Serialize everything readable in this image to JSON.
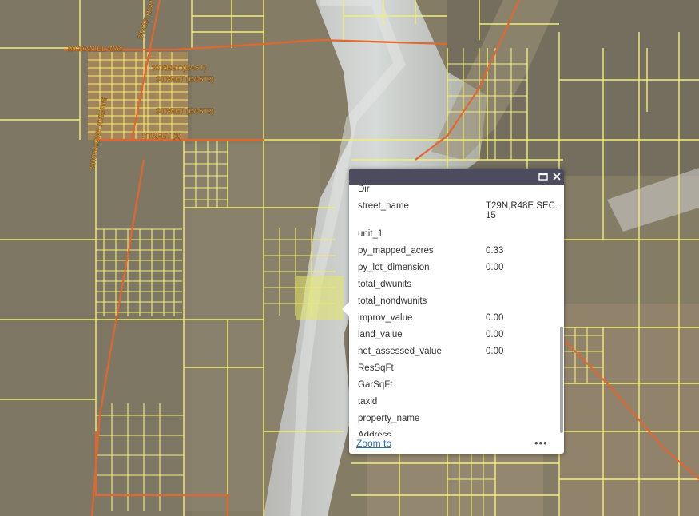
{
  "map": {
    "street_labels": [
      "MCDANIEL WAY",
      "SHOSHONE AVENUE",
      "STATE ROUTE",
      "STREET (EAST)",
      "STREET (EAST2)",
      "STREET (EAST2)",
      "STREET (1)"
    ],
    "colors": {
      "parcel": "#f4ef74",
      "road": "#e2672e",
      "label": "#f2a33a"
    }
  },
  "popup": {
    "maximize_icon": "maximize-icon",
    "close_icon": "close-icon",
    "attributes": [
      {
        "key": "Dir",
        "value": ""
      },
      {
        "key": "street_name",
        "value": "T29N,R48E SEC. 15"
      },
      {
        "key": "unit_1",
        "value": ""
      },
      {
        "key": "py_mapped_acres",
        "value": "0.33"
      },
      {
        "key": "py_lot_dimension",
        "value": "0.00"
      },
      {
        "key": "total_dwunits",
        "value": ""
      },
      {
        "key": "total_nondwunits",
        "value": ""
      },
      {
        "key": "improv_value",
        "value": "0.00"
      },
      {
        "key": "land_value",
        "value": "0.00"
      },
      {
        "key": "net_assessed_value",
        "value": "0.00"
      },
      {
        "key": "ResSqFt",
        "value": ""
      },
      {
        "key": "GarSqFt",
        "value": ""
      },
      {
        "key": "taxid",
        "value": ""
      },
      {
        "key": "property_name",
        "value": ""
      },
      {
        "key": "Address",
        "value": ""
      }
    ],
    "zoom_to": "Zoom to",
    "more": "•••"
  }
}
